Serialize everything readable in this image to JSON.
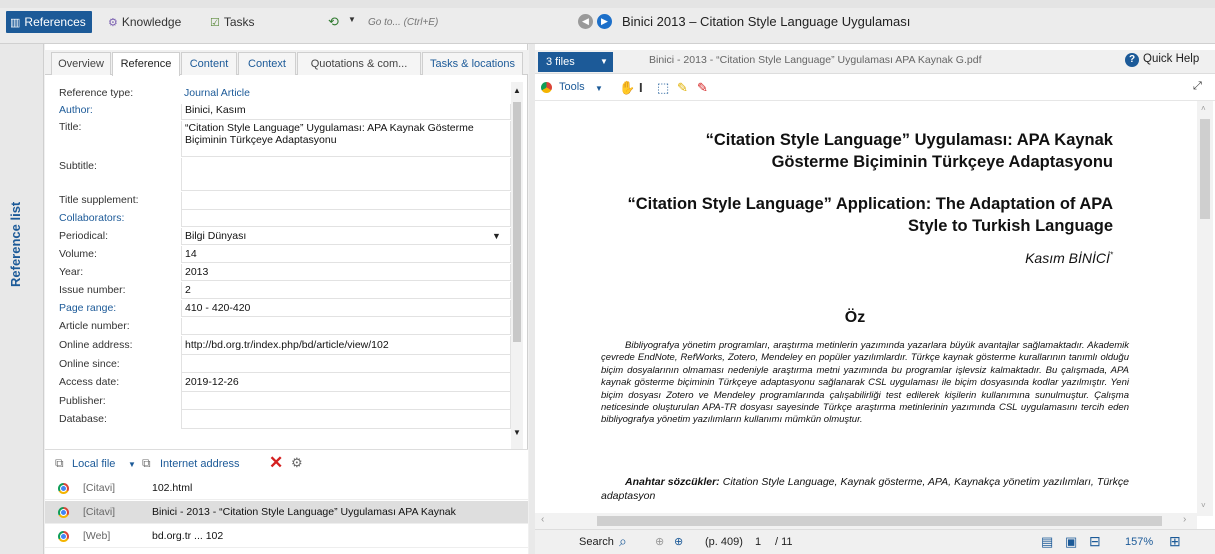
{
  "topbar": {
    "references": "References",
    "knowledge": "Knowledge",
    "tasks": "Tasks",
    "goto_placeholder": "Go to... (Ctrl+E)",
    "document_title": "Binici 2013 – Citation Style Language Uygulaması"
  },
  "rail": {
    "label": "Reference list"
  },
  "tabs": [
    "Overview",
    "Reference",
    "Content",
    "Context",
    "Quotations & com...",
    "Tasks & locations"
  ],
  "fields": [
    {
      "label": "Reference type:",
      "value": "Journal Article"
    },
    {
      "label": "Author:",
      "value": "Binici, Kasım"
    },
    {
      "label": "Title:",
      "value": "“Citation Style Language” Uygulaması: APA Kaynak Gösterme Biçiminin Türkçeye Adaptasyonu"
    },
    {
      "label": "Subtitle:",
      "value": ""
    },
    {
      "label": "Title supplement:",
      "value": ""
    },
    {
      "label": "Collaborators:",
      "value": ""
    },
    {
      "label": "Periodical:",
      "value": "Bilgi Dünyası"
    },
    {
      "label": "Volume:",
      "value": "14"
    },
    {
      "label": "Year:",
      "value": "2013"
    },
    {
      "label": "Issue number:",
      "value": "2"
    },
    {
      "label": "Page range:",
      "value": "410 - 420-420"
    },
    {
      "label": "Article number:",
      "value": ""
    },
    {
      "label": "Online address:",
      "value": "http://bd.org.tr/index.php/bd/article/view/102"
    },
    {
      "label": "Online since:",
      "value": ""
    },
    {
      "label": "Access date:",
      "value": "2019-12-26"
    },
    {
      "label": "Publisher:",
      "value": ""
    },
    {
      "label": "Database:",
      "value": ""
    }
  ],
  "location_toolbar": {
    "local_file": "Local file",
    "internet_address": "Internet address"
  },
  "locations": [
    {
      "source": "[Citavi]",
      "name": "102.html"
    },
    {
      "source": "[Citavi]",
      "name": "Binici - 2013 - “Citation Style Language” Uygulaması APA Kaynak"
    },
    {
      "source": "[Web]",
      "name": "bd.org.tr ... 102"
    }
  ],
  "viewer": {
    "files_label": "3 files",
    "pdf_name": "Binici - 2013 - “Citation Style Language” Uygulaması APA Kaynak G.pdf",
    "quick_help": "Quick Help",
    "tools_label": "Tools"
  },
  "document": {
    "title_tr": "“Citation Style Language” Uygulaması: APA Kaynak Gösterme Biçiminin Türkçeye Adaptasyonu",
    "title_en": "“Citation Style Language” Application: The Adaptation of APA Style to Turkish Language",
    "author": "Kasım BİNİCİ",
    "author_mark": "*",
    "abstract_heading": "Öz",
    "abstract": "Bibliyografya yönetim programları, araştırma metinlerin yazımında yazarlara büyük avantajlar sağlamaktadır. Akademik çevrede EndNote, RefWorks, Zotero, Mendeley en popüler yazılımlardır. Türkçe kaynak gösterme kurallarının tanımlı olduğu biçim dosyalarının olmaması nedeniyle araştırma metni yazımında bu programlar işlevsiz kalmaktadır. Bu çalışmada, APA kaynak gösterme biçiminin Türkçeye adaptasyonu sağlanarak CSL uygulaması ile biçim dosyasında kodlar yazılmıştır. Yeni biçim dosyası Zotero ve Mendeley programlarında çalışabilirliği test edilerek kişilerin kullanımına sunulmuştur. Çalışma neticesinde oluşturulan APA-TR dosyası sayesinde Türkçe araştırma metinlerinin yazımında CSL uygulamasını tercih eden bibliyografya yönetim yazılımların kullanımı mümkün olmuştur.",
    "keywords_label": "Anahtar sözcükler:",
    "keywords": "Citation Style Language, Kaynak gösterme, APA, Kaynakça yönetim yazılımları, Türkçe adaptasyon"
  },
  "status": {
    "search": "Search",
    "page_ref": "(p. 409)",
    "page_current": "1",
    "page_total": "/ 11",
    "zoom": "157%"
  }
}
